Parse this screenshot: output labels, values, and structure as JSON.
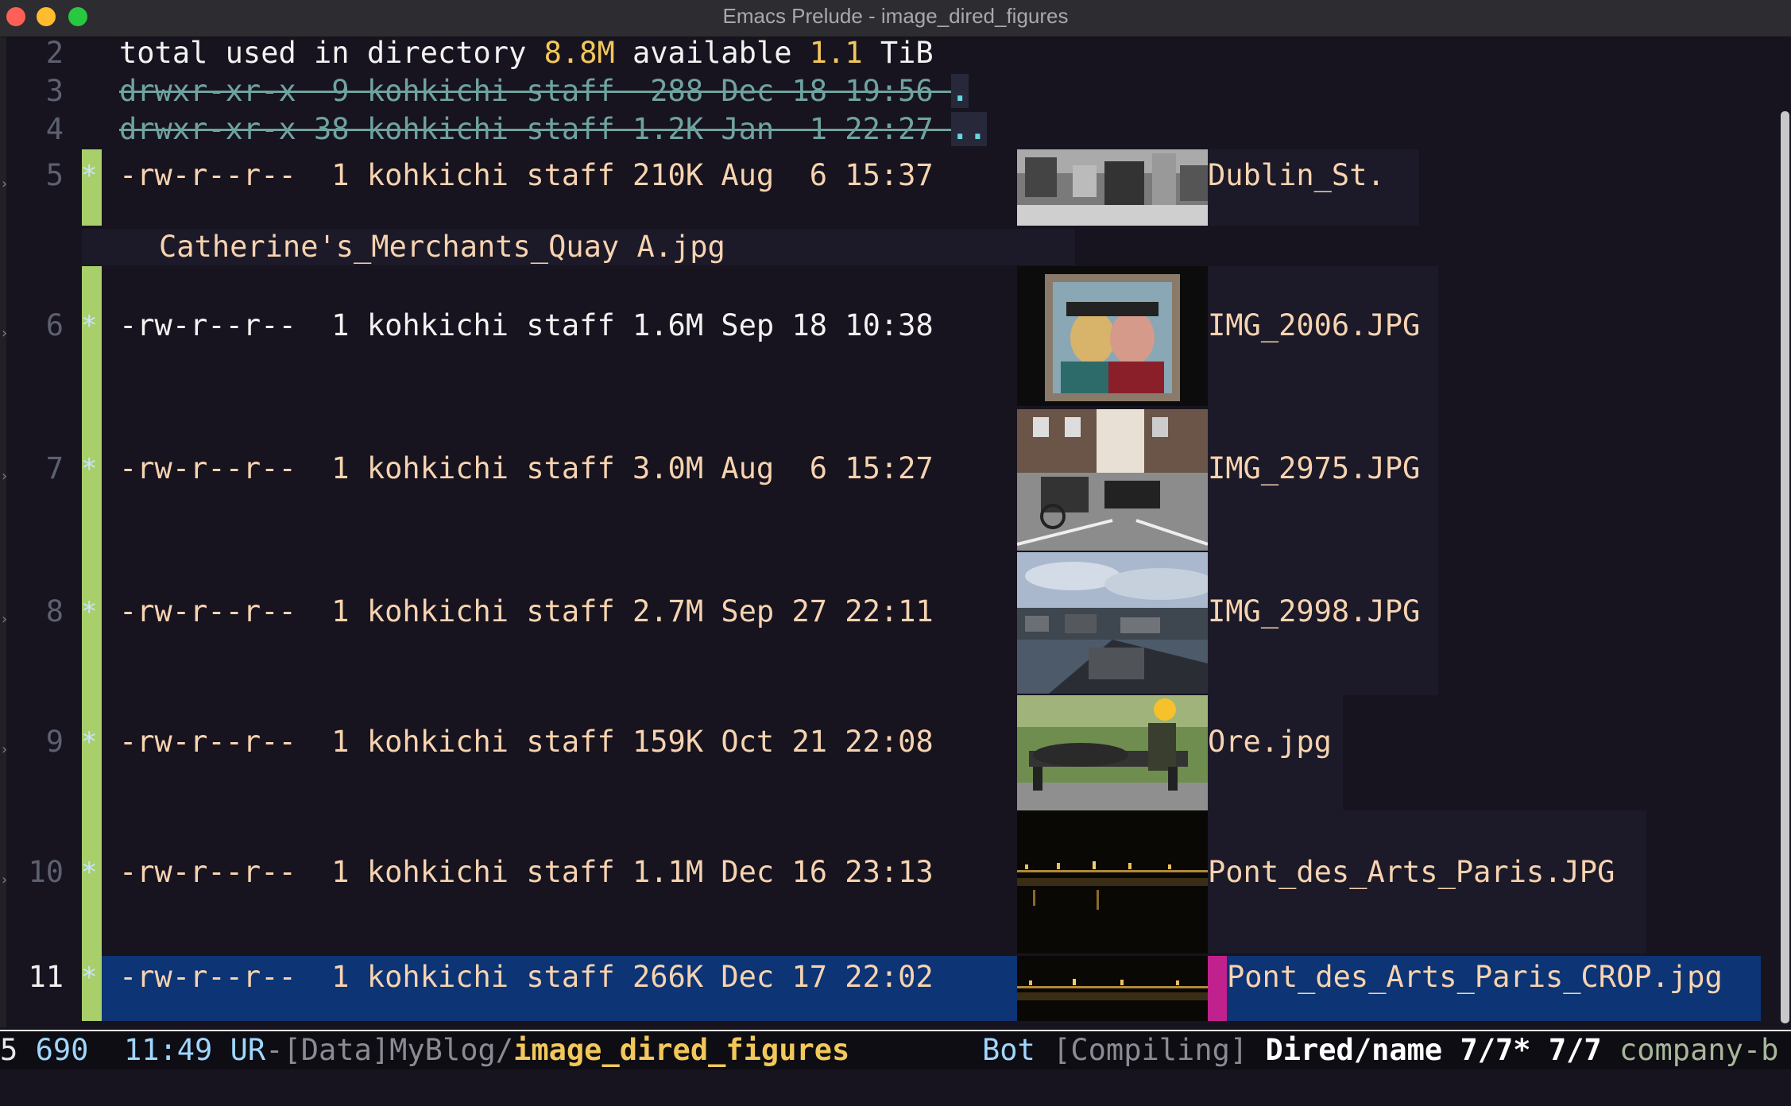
{
  "window": {
    "title": "Emacs Prelude - image_dired_figures"
  },
  "header_line": {
    "number": "2",
    "prefix": "total used in directory ",
    "used": "8.8M",
    "middle": " available ",
    "available": "1.1",
    "suffix": " TiB"
  },
  "dir_entries": [
    {
      "number": "3",
      "text": "drwxr-xr-x  9 kohkichi staff  288 Dec 18 19:56 ",
      "name": "."
    },
    {
      "number": "4",
      "text": "drwxr-xr-x 38 kohkichi staff 1.2K Jan  1 22:27 ",
      "name": ".."
    }
  ],
  "files": [
    {
      "number": "5",
      "marker": "*",
      "attrs": "-rw-r--r--  1 kohkichi staff 210K Aug  6 15:37",
      "name": "Dublin_St.",
      "name_cont": "Catherine's_Merchants_Quay A.jpg",
      "thumb_icon": "street-photo-thumbnail"
    },
    {
      "number": "6",
      "marker": "*",
      "attrs": "-rw-r--r--  1 kohkichi staff 1.6M Sep 18 10:38",
      "name": "IMG_2006.JPG",
      "thumb_icon": "painting-thumbnail"
    },
    {
      "number": "7",
      "marker": "*",
      "attrs": "-rw-r--r--  1 kohkichi staff 3.0M Aug  6 15:27",
      "name": "IMG_2975.JPG",
      "thumb_icon": "horse-carriage-thumbnail"
    },
    {
      "number": "8",
      "marker": "*",
      "attrs": "-rw-r--r--  1 kohkichi staff 2.7M Sep 27 22:11",
      "name": "IMG_2998.JPG",
      "thumb_icon": "cityscape-thumbnail"
    },
    {
      "number": "9",
      "marker": "*",
      "attrs": "-rw-r--r--  1 kohkichi staff 159K Oct 21 22:08",
      "name": "Ore.jpg",
      "thumb_icon": "bench-statue-thumbnail"
    },
    {
      "number": "10",
      "marker": "*",
      "attrs": "-rw-r--r--  1 kohkichi staff 1.1M Dec 16 23:13",
      "name": "Pont_des_Arts_Paris.JPG",
      "thumb_icon": "night-bridge-thumbnail"
    },
    {
      "number": "11",
      "marker": "*",
      "attrs": "-rw-r--r--  1 kohkichi staff 266K Dec 17 22:02",
      "name": "Pont_des_Arts_Paris_CROP.jpg",
      "thumb_icon": "night-bridge-crop-thumbnail"
    }
  ],
  "modeline": {
    "col": "5",
    "pos": "690",
    "time": "11:49",
    "flags": "UR",
    "dash": "-",
    "path_prefix": "[Data]MyBlog/",
    "buffer": "image_dired_figures",
    "position": "Bot",
    "process": "[Compiling]",
    "mode": "Dired/name 7/7* 7/7",
    "minor": "company-b"
  },
  "colors": {
    "accent_yellow": "#f2c85a",
    "mark_green": "#a8cf6a",
    "selection": "#0d3474",
    "cursor": "#c1218c"
  }
}
